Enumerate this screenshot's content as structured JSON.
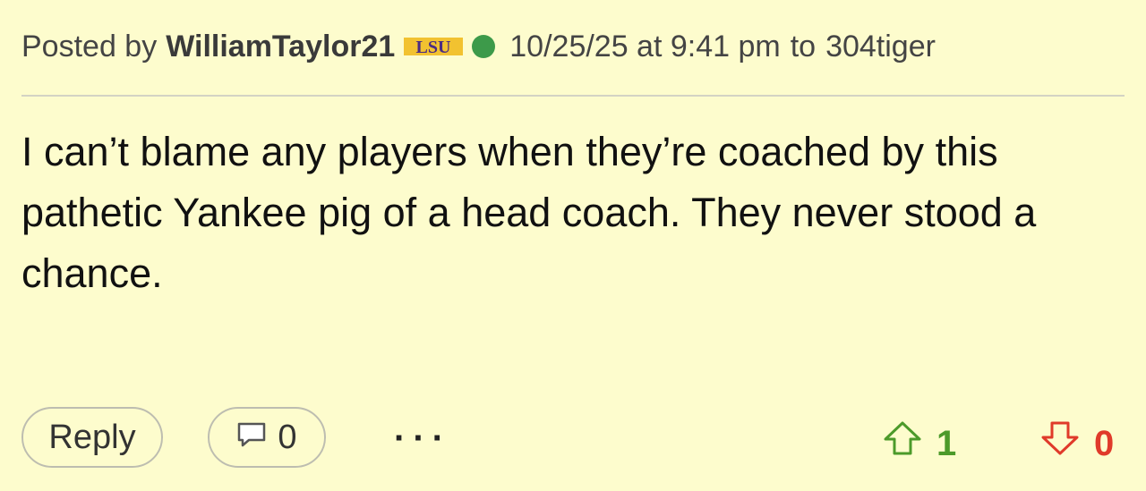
{
  "post": {
    "posted_by_label": "Posted by",
    "username": "WilliamTaylor21",
    "team_logo_text": "LSU",
    "timestamp": "10/25/25 at 9:41 pm",
    "to_label": "to",
    "reply_to_user": "304tiger",
    "body": "I can’t blame any players when they’re coached by this pathetic Yankee pig of a head coach. They never stood a chance."
  },
  "actions": {
    "reply_label": "Reply",
    "comment_count": "0",
    "more_label": "···"
  },
  "votes": {
    "up_count": "1",
    "down_count": "0"
  },
  "colors": {
    "background": "#fdfccd",
    "online": "#3d9a4a",
    "upvote": "#4c9a2a",
    "downvote": "#e03a2a",
    "lsu_purple": "#4b2c82",
    "lsu_gold": "#f2c230"
  },
  "icons": [
    "lsu-logo-icon",
    "online-status-icon",
    "comment-bubble-icon",
    "upvote-arrow-icon",
    "downvote-arrow-icon"
  ]
}
